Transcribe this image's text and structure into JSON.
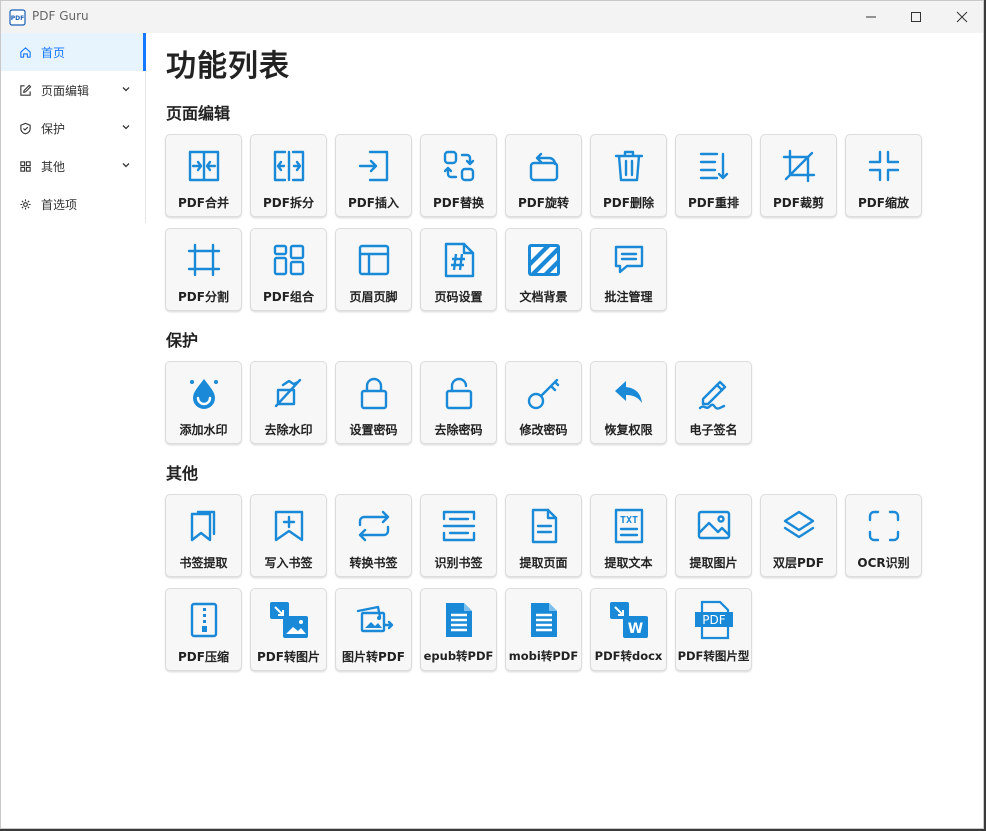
{
  "app": {
    "title": "PDF Guru"
  },
  "sidebar": {
    "items": [
      {
        "label": "首页",
        "icon": "home-icon",
        "active": true
      },
      {
        "label": "页面编辑",
        "icon": "edit-icon",
        "expandable": true
      },
      {
        "label": "保护",
        "icon": "shield-icon",
        "expandable": true
      },
      {
        "label": "其他",
        "icon": "grid-icon",
        "expandable": true
      },
      {
        "label": "首选项",
        "icon": "gear-icon"
      }
    ]
  },
  "main": {
    "title": "功能列表",
    "sections": [
      {
        "title": "页面编辑",
        "items": [
          {
            "label": "PDF合并",
            "icon": "merge-icon"
          },
          {
            "label": "PDF拆分",
            "icon": "split-icon"
          },
          {
            "label": "PDF插入",
            "icon": "insert-icon"
          },
          {
            "label": "PDF替换",
            "icon": "replace-icon"
          },
          {
            "label": "PDF旋转",
            "icon": "rotate-icon"
          },
          {
            "label": "PDF删除",
            "icon": "trash-icon"
          },
          {
            "label": "PDF重排",
            "icon": "reorder-icon"
          },
          {
            "label": "PDF裁剪",
            "icon": "crop-icon"
          },
          {
            "label": "PDF缩放",
            "icon": "scale-icon"
          },
          {
            "label": "PDF分割",
            "icon": "cut-grid-icon"
          },
          {
            "label": "PDF组合",
            "icon": "combine-icon"
          },
          {
            "label": "页眉页脚",
            "icon": "header-footer-icon"
          },
          {
            "label": "页码设置",
            "icon": "page-number-icon"
          },
          {
            "label": "文档背景",
            "icon": "background-icon"
          },
          {
            "label": "批注管理",
            "icon": "annotation-icon"
          }
        ]
      },
      {
        "title": "保护",
        "items": [
          {
            "label": "添加水印",
            "icon": "watermark-icon"
          },
          {
            "label": "去除水印",
            "icon": "remove-watermark-icon"
          },
          {
            "label": "设置密码",
            "icon": "lock-icon"
          },
          {
            "label": "去除密码",
            "icon": "unlock-icon"
          },
          {
            "label": "修改密码",
            "icon": "key-icon"
          },
          {
            "label": "恢复权限",
            "icon": "undo-icon"
          },
          {
            "label": "电子签名",
            "icon": "signature-icon"
          }
        ]
      },
      {
        "title": "其他",
        "items": [
          {
            "label": "书签提取",
            "icon": "bookmark-extract-icon"
          },
          {
            "label": "写入书签",
            "icon": "bookmark-add-icon"
          },
          {
            "label": "转换书签",
            "icon": "convert-icon"
          },
          {
            "label": "识别书签",
            "icon": "scan-icon"
          },
          {
            "label": "提取页面",
            "icon": "page-icon"
          },
          {
            "label": "提取文本",
            "icon": "text-icon"
          },
          {
            "label": "提取图片",
            "icon": "image-icon"
          },
          {
            "label": "双层PDF",
            "icon": "layers-icon"
          },
          {
            "label": "OCR识别",
            "icon": "ocr-icon"
          },
          {
            "label": "PDF压缩",
            "icon": "zip-icon"
          },
          {
            "label": "PDF转图片",
            "icon": "pdf-to-image-icon"
          },
          {
            "label": "图片转PDF",
            "icon": "images-to-pdf-icon"
          },
          {
            "label": "epub转PDF",
            "icon": "epub-icon"
          },
          {
            "label": "mobi转PDF",
            "icon": "mobi-icon"
          },
          {
            "label": "PDF转docx",
            "icon": "pdf-to-docx-icon"
          },
          {
            "label": "PDF转图片型",
            "icon": "pdf-badge-icon"
          }
        ]
      }
    ]
  },
  "colors": {
    "accent": "#1a8ad8",
    "active_bg": "#e8f4fd",
    "card_bg": "#f7f7f7"
  }
}
